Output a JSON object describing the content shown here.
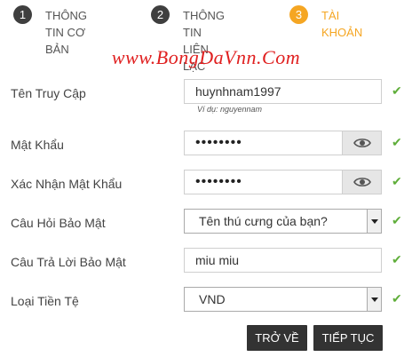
{
  "steps": [
    {
      "number": "1",
      "line1": "THÔNG TIN CƠ",
      "line2": "BẢN"
    },
    {
      "number": "2",
      "line1": "THÔNG TIN LIÊN",
      "line2": "LẠC"
    },
    {
      "number": "3",
      "line1": "TÀI KHOẢN",
      "line2": ""
    }
  ],
  "watermark": "www.BongDaVnn.Com",
  "form": {
    "username": {
      "label": "Tên Truy Cập",
      "value": "huynhnam1997",
      "hint": "Ví dụ: nguyennam"
    },
    "password": {
      "label": "Mật Khẩu",
      "value": "••••••••"
    },
    "confirm_password": {
      "label": "Xác Nhận Mật Khẩu",
      "value": "••••••••"
    },
    "security_question": {
      "label": "Câu Hỏi Bảo Mật",
      "value": "Tên thú cưng của bạn?"
    },
    "security_answer": {
      "label": "Câu Trả Lời Bảo Mật",
      "value": "miu miu"
    },
    "currency": {
      "label": "Loại Tiền Tệ",
      "value": "VND"
    }
  },
  "buttons": {
    "back": "TRỞ VỀ",
    "next": "TIẾP TỤC"
  },
  "colors": {
    "active_step": "#f5a623",
    "check": "#5fae3a",
    "watermark": "#e02020"
  },
  "icons": {
    "check": "✔",
    "eye": "eye-icon"
  }
}
